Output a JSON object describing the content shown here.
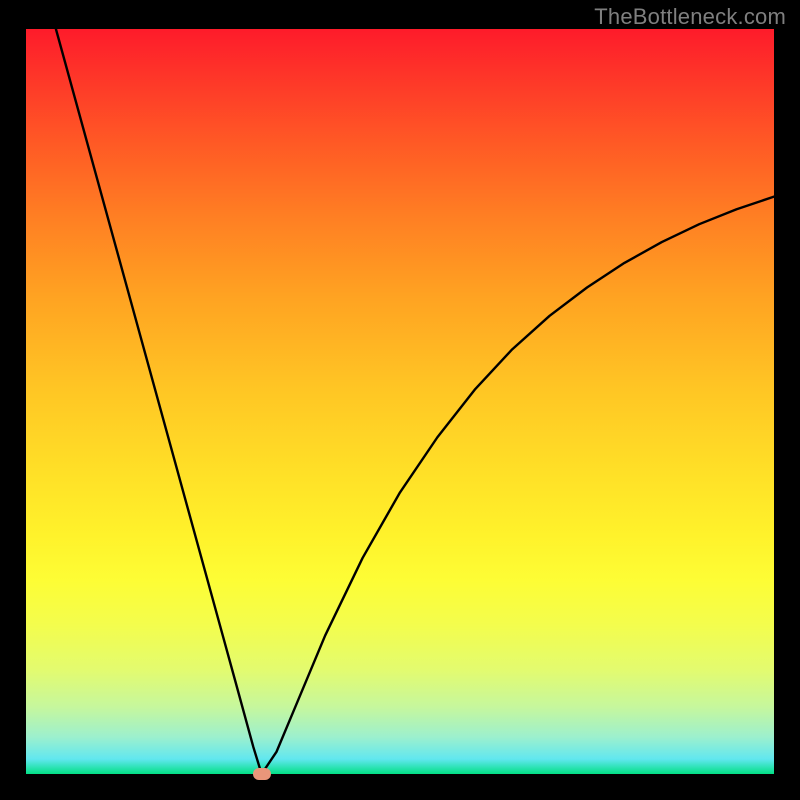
{
  "watermark": "TheBottleneck.com",
  "chart_data": {
    "type": "line",
    "title": "",
    "xlabel": "",
    "ylabel": "",
    "xlim": [
      0,
      100
    ],
    "ylim": [
      0,
      100
    ],
    "grid": false,
    "legend": false,
    "background_gradient": {
      "top_color": "#fe1b2a",
      "mid_color": "#fff22b",
      "bottom_color": "#02e085"
    },
    "series": [
      {
        "name": "bottleneck-curve",
        "color": "#000000",
        "x": [
          4.0,
          8.0,
          12.0,
          16.0,
          20.0,
          24.0,
          28.0,
          30.4,
          31.5,
          33.5,
          36.0,
          40.0,
          45.0,
          50.0,
          55.0,
          60.0,
          65.0,
          70.0,
          75.0,
          80.0,
          85.0,
          90.0,
          95.0,
          100.0
        ],
        "values": [
          100.0,
          85.4,
          70.8,
          56.2,
          41.6,
          27.0,
          12.4,
          3.6,
          0.0,
          3.0,
          9.0,
          18.6,
          29.0,
          37.8,
          45.2,
          51.6,
          57.0,
          61.5,
          65.3,
          68.6,
          71.4,
          73.8,
          75.8,
          77.5
        ]
      }
    ],
    "marker": {
      "name": "optimal-point",
      "x": 31.5,
      "y": 0.0,
      "color": "#e9967a"
    }
  }
}
